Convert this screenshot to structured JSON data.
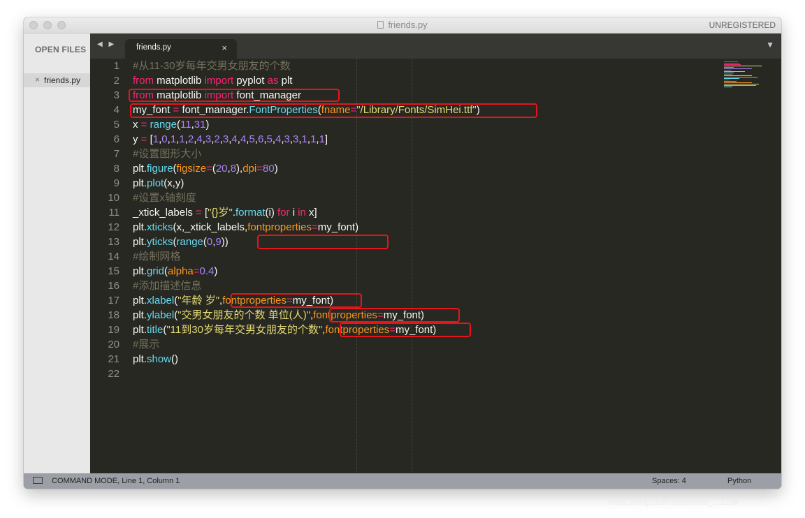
{
  "window": {
    "title": "friends.py",
    "unregistered": "UNREGISTERED"
  },
  "sidebar": {
    "heading": "OPEN FILES",
    "files": [
      {
        "name": "friends.py",
        "close": "×"
      }
    ]
  },
  "tabs": {
    "nav_arrows": "◀ ▶",
    "items": [
      {
        "label": "friends.py",
        "close": "×"
      }
    ],
    "menu_glyph": "▼"
  },
  "editor": {
    "theme_colors": {
      "background": "#272822",
      "comment": "#75715e",
      "keyword": "#f92672",
      "function": "#66d9ef",
      "string": "#e6db74",
      "number": "#ae81ff",
      "parameter": "#fd971f",
      "highlight_box": "#e8141b"
    },
    "lines": [
      {
        "n": "1",
        "tokens": [
          [
            "cm",
            "#从11-30岁每年交男女朋友的个数"
          ]
        ]
      },
      {
        "n": "2",
        "tokens": [
          [
            "kw",
            "from"
          ],
          [
            "tx",
            " matplotlib "
          ],
          [
            "kw",
            "import"
          ],
          [
            "tx",
            " pyplot "
          ],
          [
            "kw",
            "as"
          ],
          [
            "tx",
            " plt"
          ]
        ]
      },
      {
        "n": "3",
        "tokens": [
          [
            "kw",
            "from"
          ],
          [
            "tx",
            " matplotlib "
          ],
          [
            "kw",
            "import"
          ],
          [
            "tx",
            " font_manager"
          ]
        ]
      },
      {
        "n": "4",
        "tokens": [
          [
            "tx",
            "my_font "
          ],
          [
            "kw",
            "="
          ],
          [
            "tx",
            " font_manager."
          ],
          [
            "fn",
            "FontProperties"
          ],
          [
            "tx",
            "("
          ],
          [
            "pa",
            "fname"
          ],
          [
            "kw",
            "="
          ],
          [
            "st",
            "\"/Library/Fonts/SimHei.ttf\""
          ],
          [
            "tx",
            ")"
          ]
        ]
      },
      {
        "n": "5",
        "tokens": [
          [
            "tx",
            "x "
          ],
          [
            "kw",
            "="
          ],
          [
            "tx",
            " "
          ],
          [
            "fn",
            "range"
          ],
          [
            "tx",
            "("
          ],
          [
            "nm",
            "11"
          ],
          [
            "tx",
            ","
          ],
          [
            "nm",
            "31"
          ],
          [
            "tx",
            ")"
          ]
        ]
      },
      {
        "n": "6",
        "tokens": [
          [
            "tx",
            "y "
          ],
          [
            "kw",
            "="
          ],
          [
            "tx",
            " ["
          ],
          [
            "nm",
            "1"
          ],
          [
            "tx",
            ","
          ],
          [
            "nm",
            "0"
          ],
          [
            "tx",
            ","
          ],
          [
            "nm",
            "1"
          ],
          [
            "tx",
            ","
          ],
          [
            "nm",
            "1"
          ],
          [
            "tx",
            ","
          ],
          [
            "nm",
            "2"
          ],
          [
            "tx",
            ","
          ],
          [
            "nm",
            "4"
          ],
          [
            "tx",
            ","
          ],
          [
            "nm",
            "3"
          ],
          [
            "tx",
            ","
          ],
          [
            "nm",
            "2"
          ],
          [
            "tx",
            ","
          ],
          [
            "nm",
            "3"
          ],
          [
            "tx",
            ","
          ],
          [
            "nm",
            "4"
          ],
          [
            "tx",
            ","
          ],
          [
            "nm",
            "4"
          ],
          [
            "tx",
            ","
          ],
          [
            "nm",
            "5"
          ],
          [
            "tx",
            ","
          ],
          [
            "nm",
            "6"
          ],
          [
            "tx",
            ","
          ],
          [
            "nm",
            "5"
          ],
          [
            "tx",
            ","
          ],
          [
            "nm",
            "4"
          ],
          [
            "tx",
            ","
          ],
          [
            "nm",
            "3"
          ],
          [
            "tx",
            ","
          ],
          [
            "nm",
            "3"
          ],
          [
            "tx",
            ","
          ],
          [
            "nm",
            "1"
          ],
          [
            "tx",
            ","
          ],
          [
            "nm",
            "1"
          ],
          [
            "tx",
            ","
          ],
          [
            "nm",
            "1"
          ],
          [
            "tx",
            "]"
          ]
        ]
      },
      {
        "n": "7",
        "tokens": [
          [
            "cm",
            "#设置图形大小"
          ]
        ]
      },
      {
        "n": "8",
        "tokens": [
          [
            "tx",
            "plt."
          ],
          [
            "fn",
            "figure"
          ],
          [
            "tx",
            "("
          ],
          [
            "pa",
            "figsize"
          ],
          [
            "kw",
            "="
          ],
          [
            "tx",
            "("
          ],
          [
            "nm",
            "20"
          ],
          [
            "tx",
            ","
          ],
          [
            "nm",
            "8"
          ],
          [
            "tx",
            "),"
          ],
          [
            "pa",
            "dpi"
          ],
          [
            "kw",
            "="
          ],
          [
            "nm",
            "80"
          ],
          [
            "tx",
            ")"
          ]
        ]
      },
      {
        "n": "9",
        "tokens": [
          [
            "tx",
            "plt."
          ],
          [
            "fn",
            "plot"
          ],
          [
            "tx",
            "(x,y)"
          ]
        ]
      },
      {
        "n": "10",
        "tokens": [
          [
            "cm",
            "#设置x轴刻度"
          ]
        ]
      },
      {
        "n": "11",
        "tokens": [
          [
            "tx",
            "_xtick_labels "
          ],
          [
            "kw",
            "="
          ],
          [
            "tx",
            " ["
          ],
          [
            "st",
            "\"{}岁\""
          ],
          [
            "tx",
            "."
          ],
          [
            "fn",
            "format"
          ],
          [
            "tx",
            "(i) "
          ],
          [
            "kw",
            "for"
          ],
          [
            "tx",
            " i "
          ],
          [
            "kw",
            "in"
          ],
          [
            "tx",
            " x]"
          ]
        ]
      },
      {
        "n": "12",
        "tokens": [
          [
            "tx",
            "plt."
          ],
          [
            "fn",
            "xticks"
          ],
          [
            "tx",
            "(x,_xtick_labels,"
          ],
          [
            "pa",
            "fontproperties"
          ],
          [
            "kw",
            "="
          ],
          [
            "tx",
            "my_font)"
          ]
        ]
      },
      {
        "n": "13",
        "tokens": [
          [
            "tx",
            "plt."
          ],
          [
            "fn",
            "yticks"
          ],
          [
            "tx",
            "("
          ],
          [
            "fn",
            "range"
          ],
          [
            "tx",
            "("
          ],
          [
            "nm",
            "0"
          ],
          [
            "tx",
            ","
          ],
          [
            "nm",
            "9"
          ],
          [
            "tx",
            "))"
          ]
        ]
      },
      {
        "n": "14",
        "tokens": [
          [
            "cm",
            "#绘制网格"
          ]
        ]
      },
      {
        "n": "15",
        "tokens": [
          [
            "tx",
            "plt."
          ],
          [
            "fn",
            "grid"
          ],
          [
            "tx",
            "("
          ],
          [
            "pa",
            "alpha"
          ],
          [
            "kw",
            "="
          ],
          [
            "nm",
            "0.4"
          ],
          [
            "tx",
            ")"
          ]
        ]
      },
      {
        "n": "16",
        "tokens": [
          [
            "cm",
            "#添加描述信息"
          ]
        ]
      },
      {
        "n": "17",
        "tokens": [
          [
            "tx",
            "plt."
          ],
          [
            "fn",
            "xlabel"
          ],
          [
            "tx",
            "("
          ],
          [
            "st",
            "\"年龄 岁\""
          ],
          [
            "tx",
            ","
          ],
          [
            "pa",
            "fontproperties"
          ],
          [
            "kw",
            "="
          ],
          [
            "tx",
            "my_font)"
          ]
        ]
      },
      {
        "n": "18",
        "tokens": [
          [
            "tx",
            "plt."
          ],
          [
            "fn",
            "ylabel"
          ],
          [
            "tx",
            "("
          ],
          [
            "st",
            "\"交男女朋友的个数 单位(人)\""
          ],
          [
            "tx",
            ","
          ],
          [
            "pa",
            "fontproperties"
          ],
          [
            "kw",
            "="
          ],
          [
            "tx",
            "my_font)"
          ]
        ]
      },
      {
        "n": "19",
        "tokens": [
          [
            "tx",
            "plt."
          ],
          [
            "fn",
            "title"
          ],
          [
            "tx",
            "("
          ],
          [
            "st",
            "\"11到30岁每年交男女朋友的个数\""
          ],
          [
            "tx",
            ","
          ],
          [
            "pa",
            "fontproperties"
          ],
          [
            "kw",
            "="
          ],
          [
            "tx",
            "my_font)"
          ]
        ]
      },
      {
        "n": "20",
        "tokens": [
          [
            "cm",
            "#展示"
          ]
        ]
      },
      {
        "n": "21",
        "tokens": [
          [
            "tx",
            "plt."
          ],
          [
            "fn",
            "show"
          ],
          [
            "tx",
            "()"
          ]
        ]
      },
      {
        "n": "22",
        "tokens": []
      }
    ]
  },
  "status": {
    "mode_text": "COMMAND MODE, Line 1, Column 1",
    "spaces": "Spaces: 4",
    "language": "Python"
  },
  "watermark": "https://blog.csdn.net/weixin_...1234"
}
